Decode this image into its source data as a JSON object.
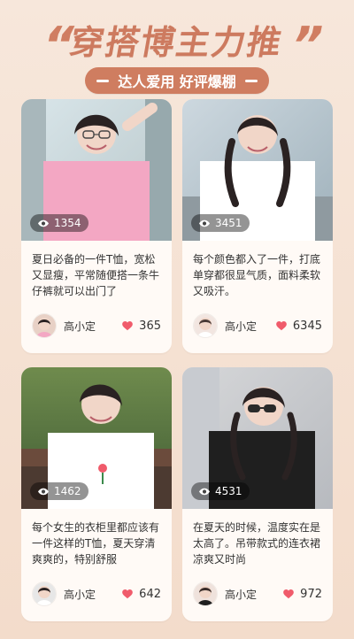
{
  "header": {
    "left_quote": "“",
    "title": "穿搭博主力推",
    "right_quote": "”",
    "subtitle": "达人爱用 好评爆棚"
  },
  "colors": {
    "background": "#f6e4d6",
    "accent": "#cf7d60",
    "heart": "#f05b6b"
  },
  "cards": [
    {
      "views": "1354",
      "description": "夏日必备的一件T恤，宽松又显瘦，平常随便搭一条牛仔裤就可以出门了",
      "author": "高小定",
      "likes": "365"
    },
    {
      "views": "3451",
      "description": "每个颜色都入了一件，打底单穿都很显气质，面料柔软又吸汗。",
      "author": "高小定",
      "likes": "6345"
    },
    {
      "views": "1462",
      "description": "每个女生的衣柜里都应该有一件这样的T恤，夏天穿清爽爽的，特别舒服",
      "author": "高小定",
      "likes": "642"
    },
    {
      "views": "4531",
      "description": "在夏天的时候，温度实在是太高了。吊带款式的连衣裙凉爽又时尚",
      "author": "高小定",
      "likes": "972"
    }
  ]
}
